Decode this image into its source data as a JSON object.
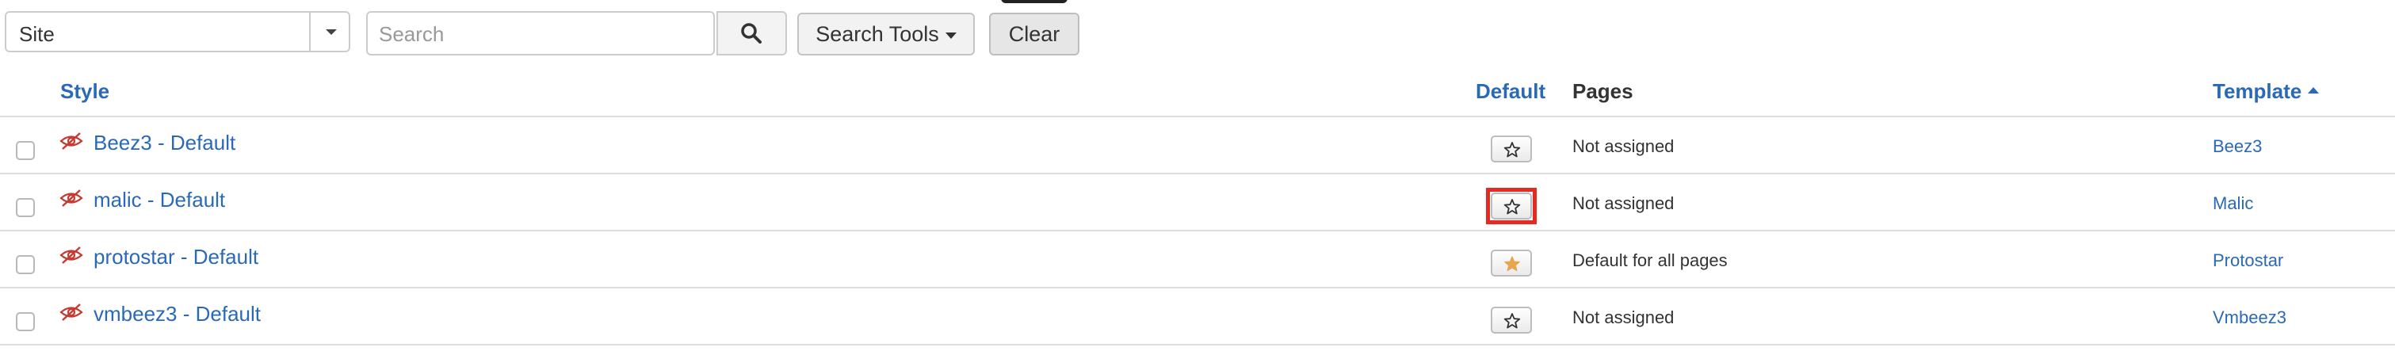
{
  "filter_select": {
    "selected": "Site"
  },
  "search": {
    "placeholder": "Search",
    "value": ""
  },
  "buttons": {
    "search_tools": "Search Tools",
    "clear": "Clear"
  },
  "table": {
    "columns": {
      "style": "Style",
      "default": "Default",
      "pages": "Pages",
      "template": "Template"
    },
    "sort": {
      "column": "template",
      "direction": "ascending"
    },
    "rows": [
      {
        "style": "Beez3 - Default",
        "default": false,
        "pages": "Not assigned",
        "template": "Beez3"
      },
      {
        "style": "malic - Default",
        "default": false,
        "pages": "Not assigned",
        "template": "Malic"
      },
      {
        "style": "protostar - Default",
        "default": true,
        "pages": "Default for all pages",
        "template": "Protostar"
      },
      {
        "style": "vmbeez3 - Default",
        "default": false,
        "pages": "Not assigned",
        "template": "Vmbeez3"
      }
    ]
  },
  "icons": {
    "unpublished": "eye-slash-icon",
    "default_off": "star-outline-icon",
    "default_on": "star-filled-icon"
  },
  "colors": {
    "link": "#2a69b8",
    "star_filled": "#e8a54f",
    "eye_slash": "#c73a32",
    "highlight": "#e32b21"
  }
}
